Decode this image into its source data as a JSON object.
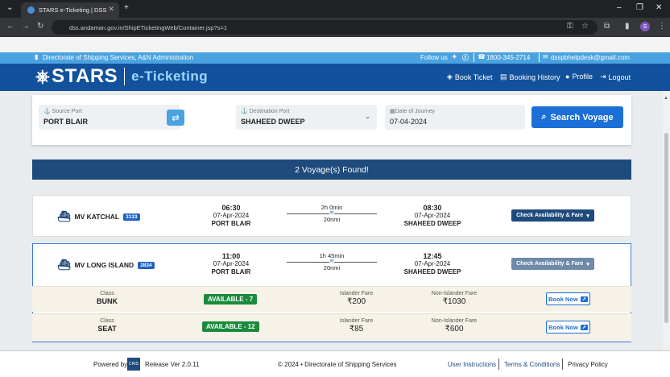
{
  "browser": {
    "tab_title": "STARS e-Ticketing | DSS",
    "new_tab": "+",
    "url": "dss.andaman.gov.in/ShipETicketingWeb/Container.jsp?s=1",
    "profile_initial": "S"
  },
  "topstrip": {
    "org": "Directorate of Shipping Services, A&N Administration",
    "follow": "Follow us",
    "phone": "1800-345-2714",
    "email": "dsspbhelpdesk@gmail.com"
  },
  "header": {
    "brand": "STARS",
    "sub": "e-Ticketing",
    "nav": [
      "Book Ticket",
      "Booking History",
      "Profile",
      "Logout"
    ]
  },
  "search": {
    "source_label": "Source Port",
    "source_value": "PORT BLAIR",
    "dest_label": "Destination Port",
    "dest_value": "SHAHEED DWEEP",
    "date_label": "Date of Journey",
    "date_value": "07-04-2024",
    "button": "Search Voyage"
  },
  "results_text": "2 Voyage(s) Found!",
  "voyages": [
    {
      "ship": "MV KATCHAL",
      "code": "3133",
      "dep_time": "06:30",
      "dep_date": "07-Apr-2024",
      "dep_port": "PORT BLAIR",
      "duration": "2h 0min",
      "distance": "20nmi",
      "arr_time": "08:30",
      "arr_date": "07-Apr-2024",
      "arr_port": "SHAHEED DWEEP",
      "button": "Check Availability & Fare"
    },
    {
      "ship": "MV LONG ISLAND",
      "code": "2834",
      "dep_time": "11:00",
      "dep_date": "07-Apr-2024",
      "dep_port": "PORT BLAIR",
      "duration": "1h 45min",
      "distance": "20nmi",
      "arr_time": "12:45",
      "arr_date": "07-Apr-2024",
      "arr_port": "SHAHEED DWEEP",
      "button": "Check Availability & Fare"
    }
  ],
  "classes": [
    {
      "class_label": "Class",
      "class_name": "BUNK",
      "availability": "AVAILABLE - 7",
      "islander_label": "Islander Fare",
      "islander_fare": "₹200",
      "non_islander_label": "Non-Islander Fare",
      "non_islander_fare": "₹1030",
      "button": "Book Now"
    },
    {
      "class_label": "Class",
      "class_name": "SEAT",
      "availability": "AVAILABLE - 12",
      "islander_label": "Islander Fare",
      "islander_fare": "₹85",
      "non_islander_label": "Non-Islander Fare",
      "non_islander_fare": "₹600",
      "button": "Book Now"
    }
  ],
  "footer": {
    "powered_by": "Powered by",
    "release": "Release Ver 2.0.11",
    "copyright": "© 2024 • Directorate of Shipping Services",
    "links": [
      "User Instructions",
      "Terms & Conditions",
      "Privacy Policy"
    ]
  },
  "colors": {
    "brand_blue": "#12519c",
    "accent": "#4aa3e0",
    "available_green": "#1a8a3c"
  }
}
